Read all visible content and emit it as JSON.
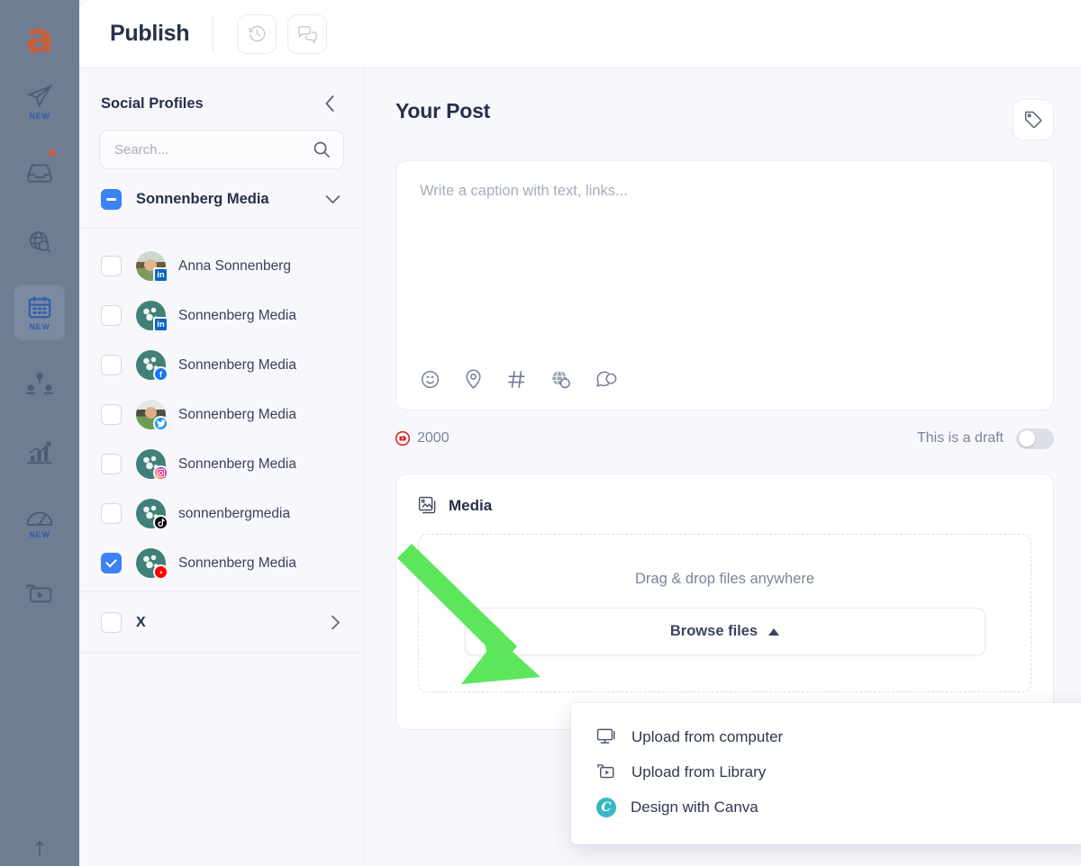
{
  "app": {
    "logo_letter": "a",
    "rail_items": [
      {
        "name": "publish-paperplane",
        "badge_label": "NEW",
        "has_dot": false,
        "active": false
      },
      {
        "name": "inbox",
        "badge_label": "",
        "has_dot": true,
        "active": false
      },
      {
        "name": "listening-globe",
        "badge_label": "",
        "has_dot": false,
        "active": false
      },
      {
        "name": "calendar",
        "badge_label": "NEW",
        "has_dot": false,
        "active": true
      },
      {
        "name": "influencers",
        "badge_label": "",
        "has_dot": false,
        "active": false
      },
      {
        "name": "analytics",
        "badge_label": "",
        "has_dot": false,
        "active": false
      },
      {
        "name": "benchmark-gauge",
        "badge_label": "NEW",
        "has_dot": false,
        "active": false
      },
      {
        "name": "media-library",
        "badge_label": "",
        "has_dot": false,
        "active": false
      }
    ]
  },
  "header": {
    "title": "Publish",
    "buttons": [
      {
        "name": "history-icon",
        "label": "History"
      },
      {
        "name": "comments-icon",
        "label": "Comments"
      }
    ]
  },
  "sidebar": {
    "title": "Social Profiles",
    "collapse_icon": "chevron-left-icon",
    "search": {
      "placeholder": "Search...",
      "value": "",
      "icon": "search-icon"
    },
    "group": {
      "label": "Sonnenberg Media",
      "checkbox_state": "indeterminate",
      "chevron": "chevron-down-icon"
    },
    "profiles": [
      {
        "name": "Anna Sonnenberg",
        "network": "linkedin",
        "avatar": "photo1",
        "checked": false
      },
      {
        "name": "Sonnenberg Media",
        "network": "linkedin",
        "avatar": "logo",
        "checked": false
      },
      {
        "name": "Sonnenberg Media",
        "network": "facebook",
        "avatar": "logo",
        "checked": false
      },
      {
        "name": "Sonnenberg Media",
        "network": "twitter",
        "avatar": "photo2",
        "checked": false
      },
      {
        "name": "Sonnenberg Media",
        "network": "instagram",
        "avatar": "logo",
        "checked": false
      },
      {
        "name": "sonnenbergmedia",
        "network": "tiktok",
        "avatar": "logo",
        "checked": false
      },
      {
        "name": "Sonnenberg Media",
        "network": "youtube",
        "avatar": "logo",
        "checked": true
      }
    ],
    "x_group": {
      "label": "X",
      "checkbox_state": "unchecked",
      "chevron": "chevron-right-icon"
    }
  },
  "post": {
    "title": "Your Post",
    "tag_button": "tag-icon",
    "composer": {
      "placeholder": "Write a caption with text, links...",
      "value": "",
      "tools": [
        {
          "name": "emoji-icon"
        },
        {
          "name": "location-pin-icon"
        },
        {
          "name": "hashtag-icon"
        },
        {
          "name": "link-globe-icon"
        },
        {
          "name": "ai-assist-icon"
        }
      ]
    },
    "counter": {
      "network_icon": "youtube-icon",
      "value": "2000"
    },
    "draft": {
      "label": "This is a draft",
      "enabled": false
    },
    "media": {
      "icon": "images-icon",
      "title": "Media",
      "dropzone_text": "Drag & drop files anywhere",
      "browse_label": "Browse files",
      "browse_caret": "caret-up-icon",
      "dropdown_open": true,
      "dropdown_items": [
        {
          "label": "Upload from computer",
          "icon": "monitor-icon"
        },
        {
          "label": "Upload from Library",
          "icon": "folder-play-icon"
        },
        {
          "label": "Design with Canva",
          "icon": "canva-icon"
        }
      ]
    }
  },
  "annotation": {
    "arrow_color": "#5ce65c",
    "points_to": "Upload from computer"
  },
  "colors": {
    "rail_bg": "#6f7d93",
    "accent_blue": "#3b82f6",
    "logo_orange": "#c0603f",
    "panel_bg": "#f8f8fc",
    "text_dark": "#27304a",
    "text_muted": "#7d8499",
    "youtube_red": "#ff0000",
    "canva_teal": "#3ab7c4"
  }
}
